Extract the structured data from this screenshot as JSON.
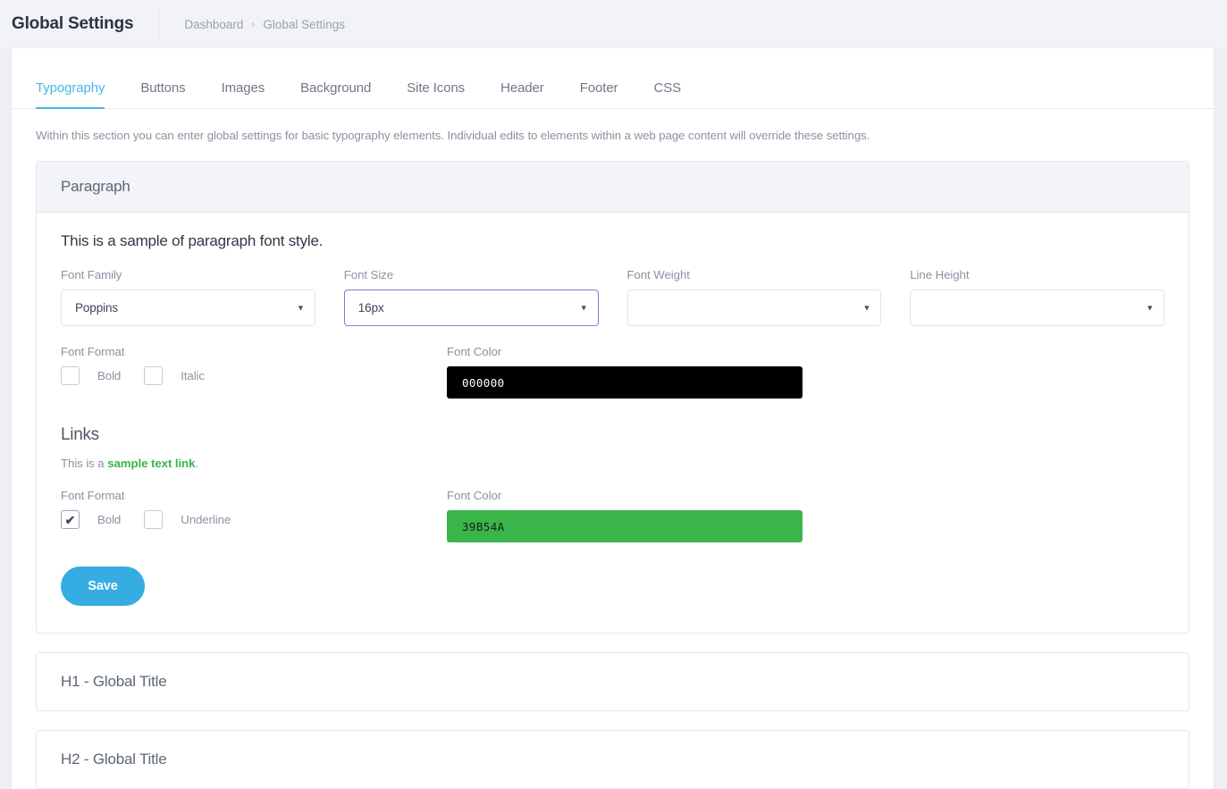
{
  "topbar": {
    "title": "Global Settings",
    "breadcrumb": [
      "Dashboard",
      "Global Settings"
    ],
    "breadcrumb_separator": "›"
  },
  "tabs": [
    {
      "label": "Typography",
      "active": true
    },
    {
      "label": "Buttons",
      "active": false
    },
    {
      "label": "Images",
      "active": false
    },
    {
      "label": "Background",
      "active": false
    },
    {
      "label": "Site Icons",
      "active": false
    },
    {
      "label": "Header",
      "active": false
    },
    {
      "label": "Footer",
      "active": false
    },
    {
      "label": "CSS",
      "active": false
    }
  ],
  "intro": "Within this section you can enter global settings for basic typography elements. Individual edits to elements within a web page content will override these settings.",
  "paragraph_panel": {
    "title": "Paragraph",
    "sample_text": "This is a sample of paragraph font style.",
    "fields": [
      {
        "label": "Font Family",
        "value": "Poppins",
        "focused": false
      },
      {
        "label": "Font Size",
        "value": "16px",
        "focused": true
      },
      {
        "label": "Font Weight",
        "value": "",
        "focused": false
      },
      {
        "label": "Line Height",
        "value": "",
        "focused": false
      }
    ],
    "font_format": {
      "label": "Font Format",
      "options": [
        {
          "label": "Bold",
          "checked": false
        },
        {
          "label": "Italic",
          "checked": false
        }
      ]
    },
    "font_color": {
      "label": "Font Color",
      "value": "000000",
      "swatch_hex": "#000000",
      "text_hex": "#ffffff"
    },
    "links": {
      "heading": "Links",
      "sample_prefix": "This is a ",
      "sample_link": "sample text link",
      "sample_suffix": ".",
      "font_format": {
        "label": "Font Format",
        "options": [
          {
            "label": "Bold",
            "checked": true
          },
          {
            "label": "Underline",
            "checked": false
          }
        ]
      },
      "font_color": {
        "label": "Font Color",
        "value": "39B54A",
        "swatch_hex": "#39b54a",
        "text_hex": "#1d1d1d"
      }
    },
    "save_label": "Save"
  },
  "collapsed_panels": [
    {
      "title": "H1 - Global Title"
    },
    {
      "title": "H2 - Global Title"
    }
  ],
  "icons": {
    "caret": "▼",
    "tick": "✔"
  },
  "colors": {
    "accent_blue": "#49b6e8",
    "save_blue": "#36ade2",
    "link_green": "#39b54a",
    "focus_purple": "#7b7fd4",
    "page_bg": "#edeff4"
  }
}
